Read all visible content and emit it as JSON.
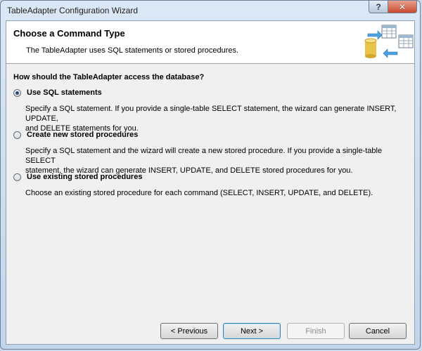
{
  "window": {
    "title": "TableAdapter Configuration Wizard",
    "help_glyph": "?",
    "close_glyph": "✕"
  },
  "header": {
    "title": "Choose a Command Type",
    "subtitle": "The TableAdapter uses SQL statements or stored procedures."
  },
  "question": "How should the TableAdapter access the database?",
  "options": [
    {
      "label": "Use SQL statements",
      "checked": true,
      "desc_lines": [
        "Specify a SQL statement. If you provide a single-table SELECT statement, the wizard can generate INSERT, UPDATE,",
        "and DELETE statements for you."
      ]
    },
    {
      "label": "Create new stored procedures",
      "checked": false,
      "desc_lines": [
        "Specify a SQL statement and the wizard will create a new stored procedure. If you provide a single-table SELECT",
        "statement, the wizard can generate INSERT, UPDATE, and DELETE stored procedures for you."
      ]
    },
    {
      "label": "Use existing stored procedures",
      "checked": false,
      "desc_lines": [
        "Choose an existing stored procedure for each command (SELECT, INSERT, UPDATE, and DELETE)."
      ]
    }
  ],
  "buttons": {
    "previous": "< Previous",
    "next": "Next >",
    "finish": "Finish",
    "cancel": "Cancel"
  },
  "colors": {
    "accent": "#3c7fb1",
    "close": "#c84a2f",
    "database": "#e8c547",
    "arrow": "#4aa3df"
  }
}
